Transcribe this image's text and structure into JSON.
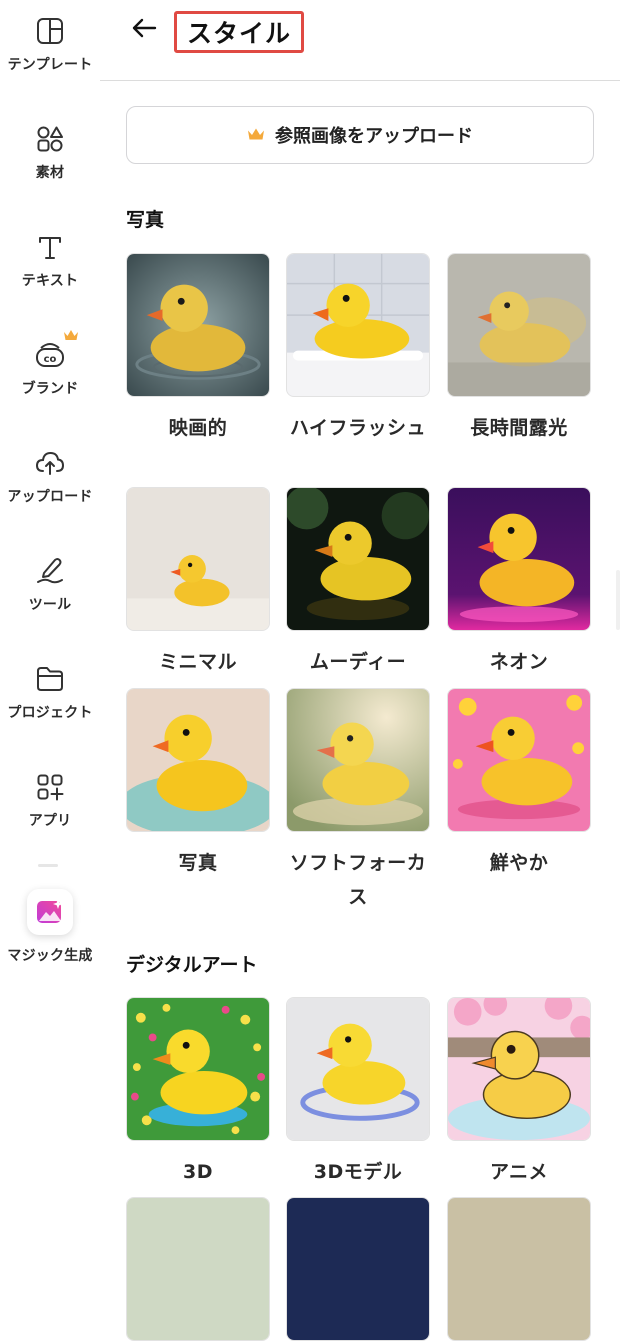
{
  "sidebar": {
    "items": [
      {
        "label": "テンプレート",
        "icon": "template-icon"
      },
      {
        "label": "素材",
        "icon": "elements-icon"
      },
      {
        "label": "テキスト",
        "icon": "text-icon"
      },
      {
        "label": "ブランド",
        "icon": "brand-icon",
        "premium": true
      },
      {
        "label": "アップロード",
        "icon": "upload-cloud-icon"
      },
      {
        "label": "ツール",
        "icon": "draw-tool-icon"
      },
      {
        "label": "プロジェクト",
        "icon": "folder-icon"
      },
      {
        "label": "アプリ",
        "icon": "apps-icon"
      },
      {
        "label": "マジック生成",
        "icon": "magic-media-icon"
      }
    ]
  },
  "header": {
    "back_icon": "arrow-left-icon",
    "title": "スタイル"
  },
  "upload": {
    "label": "参照画像をアップロード",
    "icon": "crown-icon"
  },
  "sections": [
    {
      "title": "写真",
      "styles": [
        "映画的",
        "ハイフラッシュ",
        "長時間露光",
        "ミニマル",
        "ムーディー",
        "ネオン",
        "写真",
        "ソフトフォーカス",
        "鮮やか"
      ]
    },
    {
      "title": "デジタルアート",
      "styles": [
        "3D",
        "3Dモデル",
        "アニメ"
      ]
    }
  ],
  "colors": {
    "accent_crown": "#f4a93b",
    "title_highlight": "#e04a43",
    "duck_yellow": "#f5c518",
    "beak_orange": "#f26a1b",
    "magic_gradient_start": "#c13bd8",
    "magic_gradient_end": "#f04b9a"
  }
}
